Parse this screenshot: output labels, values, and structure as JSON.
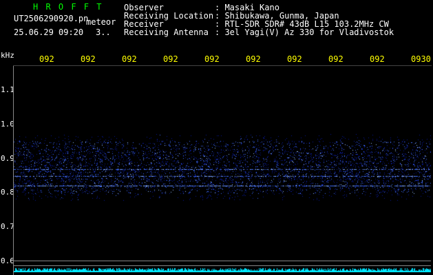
{
  "header": {
    "station": "H R O F F T",
    "filename": "UT2506290920.pn",
    "mode": "meteor",
    "datetime": "25.06.29 09:20",
    "count": "3..",
    "fields": [
      {
        "label": "Observer",
        "value": ": Masaki Kano"
      },
      {
        "label": "Receiving Location",
        "value": ": Shibukawa, Gunma, Japan"
      },
      {
        "label": "Receiver",
        "value": ": RTL-SDR SDR# 43dB L15 103.2MHz CW"
      },
      {
        "label": "Receiving Antenna",
        "value": ": 3el Yagi(V) Az 330 for Vladivostok"
      }
    ],
    "colors": {
      "station": "#00ff00",
      "text": "#ffffff",
      "time": "#ffff00"
    }
  },
  "freq_axis": {
    "unit": "kHz",
    "ticks": [
      "1.1",
      "1.0",
      "0.9",
      "0.8",
      "0.7",
      "0.6"
    ]
  },
  "time_axis": {
    "ticks": [
      "092",
      "092",
      "092",
      "092",
      "092",
      "092",
      "092",
      "092",
      "092",
      "0930"
    ]
  },
  "spectrogram": {
    "freq_range_khz": [
      0.585,
      1.205
    ],
    "signal_band_khz": [
      0.8,
      1.0
    ],
    "carrier_lines_khz": [
      0.895,
      0.875,
      0.845
    ],
    "reference_lines_khz": [
      0.62,
      0.605
    ],
    "colors": {
      "noise": "#0a1a9a",
      "signal": "#3f6cff",
      "bright": "#9fc4ff",
      "floor": "#00e5ff"
    }
  }
}
